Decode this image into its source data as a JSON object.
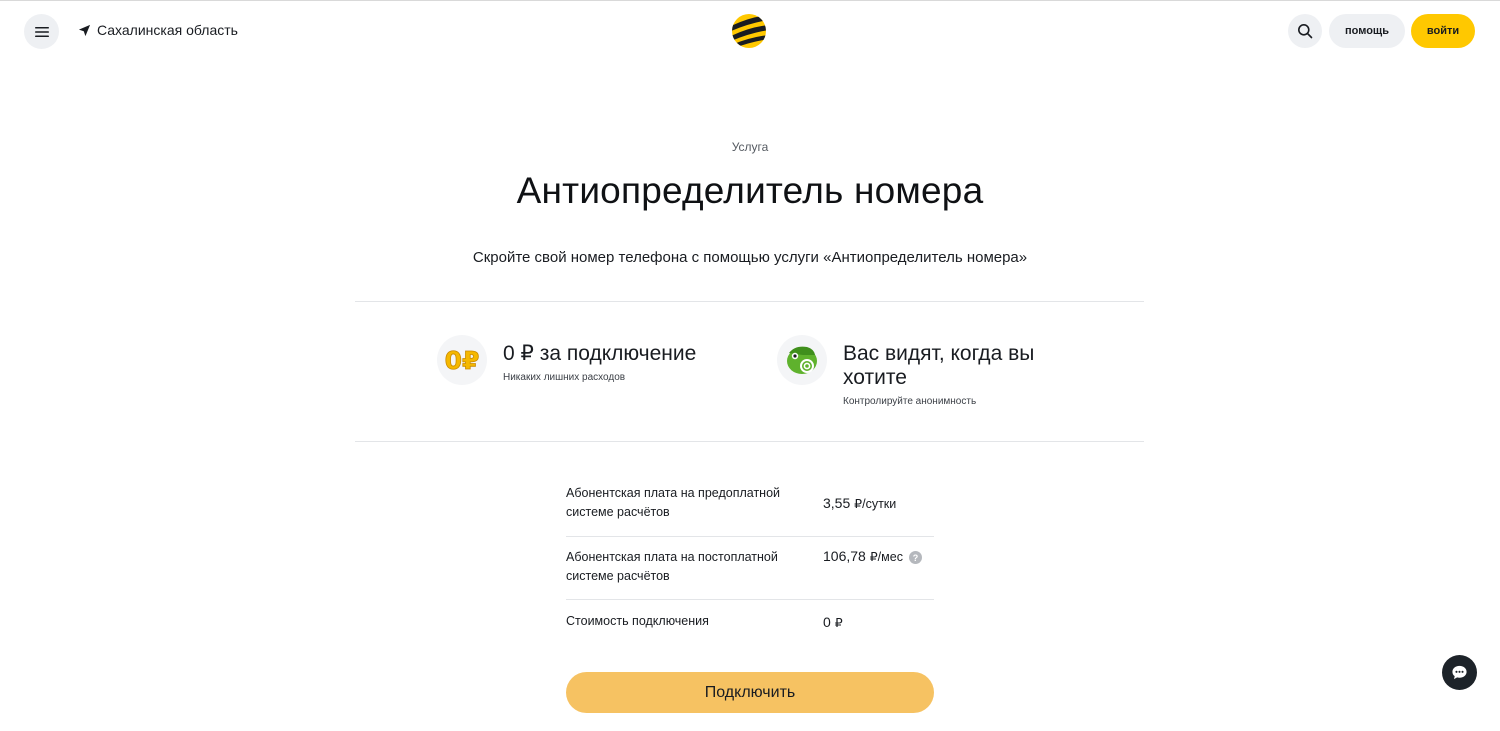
{
  "header": {
    "region": "Сахалинская область",
    "help_label": "помощь",
    "login_label": "войти"
  },
  "hero": {
    "eyebrow": "Услуга",
    "title": "Антиопределитель номера",
    "subtitle": "Скройте свой номер телефона с помощью услуги «Антиопределитель номера»"
  },
  "features": [
    {
      "title": "0 ₽ за подключение",
      "description": "Никаких лишних расходов",
      "icon": "zero-rub-icon"
    },
    {
      "title": "Вас видят, когда вы хотите",
      "description": "Контролируйте анонимность",
      "icon": "chameleon-icon"
    }
  ],
  "prices": [
    {
      "label": "Абонентская плата на предоплатной системе расчётов",
      "amount": "3,55",
      "unit": "₽/сутки"
    },
    {
      "label": "Абонентская плата на постоплатной системе расчётов",
      "amount": "106,78",
      "unit": "₽/мес",
      "help": "?"
    },
    {
      "label": "Стоимость подключения",
      "amount": "0",
      "unit": "₽"
    }
  ],
  "cta": {
    "label": "Подключить"
  },
  "colors": {
    "brand": "#ffc800",
    "cta": "#f6c262",
    "chat": "#1d2329",
    "neutral": "#eef0f3"
  }
}
